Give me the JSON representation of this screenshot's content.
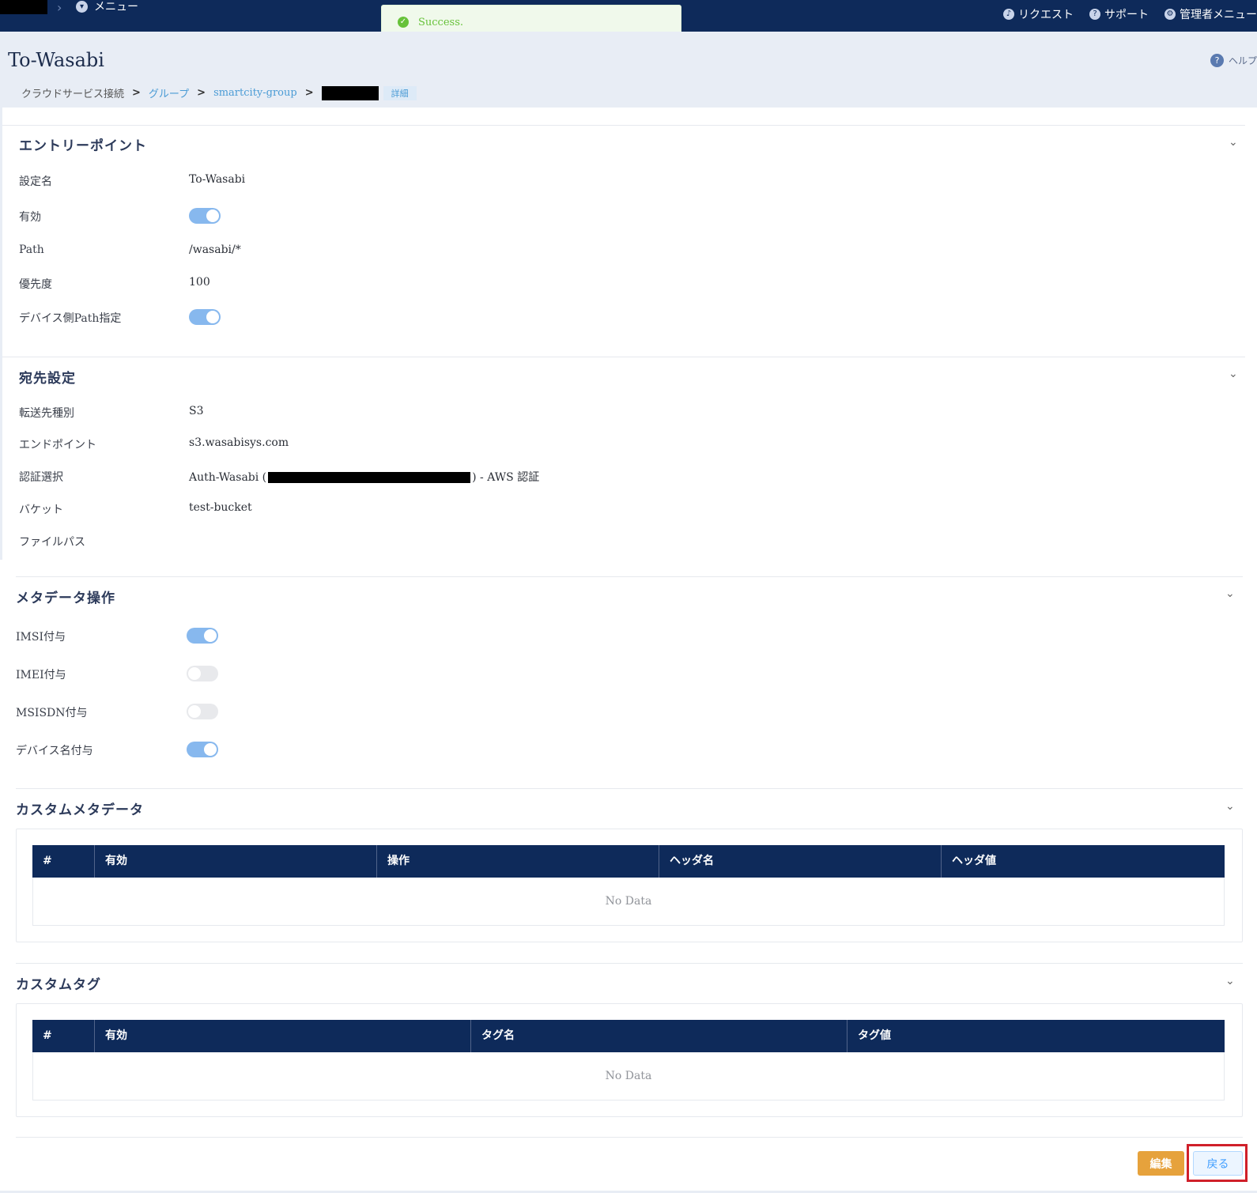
{
  "topbar": {
    "menu_label": "メニュー",
    "request_label": "リクエスト",
    "support_label": "サポート",
    "admin_label": "管理者メニュー"
  },
  "toast": {
    "message": "Success."
  },
  "header": {
    "title": "To-Wasabi",
    "help_label": "ヘルプ",
    "breadcrumb": {
      "item1": "クラウドサービス接続",
      "item2": "グループ",
      "item3": "smartcity-group",
      "tag": "詳細"
    }
  },
  "entry": {
    "title": "エントリーポイント",
    "name_label": "設定名",
    "name_value": "To-Wasabi",
    "enabled_label": "有効",
    "enabled": true,
    "path_label": "Path",
    "path_value": "/wasabi/*",
    "priority_label": "優先度",
    "priority_value": "100",
    "device_path_label": "デバイス側Path指定",
    "device_path": true
  },
  "destination": {
    "title": "宛先設定",
    "type_label": "転送先種別",
    "type_value": "S3",
    "endpoint_label": "エンドポイント",
    "endpoint_value": "s3.wasabisys.com",
    "auth_label": "認証選択",
    "auth_prefix": "Auth-Wasabi (",
    "auth_suffix": ") - AWS 認証",
    "bucket_label": "バケット",
    "bucket_value": "test-bucket",
    "filepath_label": "ファイルパス",
    "filepath_value": ""
  },
  "metadata": {
    "title": "メタデータ操作",
    "imsi_label": "IMSI付与",
    "imsi": true,
    "imei_label": "IMEI付与",
    "imei": false,
    "msisdn_label": "MSISDN付与",
    "msisdn": false,
    "device_name_label": "デバイス名付与",
    "device_name": true
  },
  "custom_metadata": {
    "title": "カスタムメタデータ",
    "columns": [
      "#",
      "有効",
      "操作",
      "ヘッダ名",
      "ヘッダ値"
    ],
    "empty_text": "No Data"
  },
  "custom_tag": {
    "title": "カスタムタグ",
    "columns": [
      "#",
      "有効",
      "タグ名",
      "タグ値"
    ],
    "empty_text": "No Data"
  },
  "footer": {
    "edit_label": "編集",
    "back_label": "戻る"
  },
  "colors": {
    "navy": "#0e2a5a",
    "toggle_on": "#87b8ee",
    "edit_button": "#e6a23c",
    "highlight_frame": "#d0202a"
  }
}
